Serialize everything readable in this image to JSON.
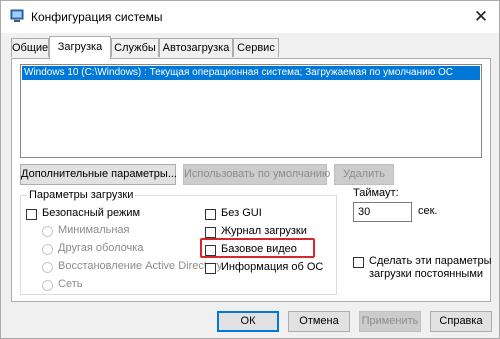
{
  "window": {
    "title": "Конфигурация системы",
    "close_glyph": "✕"
  },
  "tabs": [
    {
      "label": "Общие",
      "active": false
    },
    {
      "label": "Загрузка",
      "active": true
    },
    {
      "label": "Службы",
      "active": false
    },
    {
      "label": "Автозагрузка",
      "active": false
    },
    {
      "label": "Сервис",
      "active": false
    }
  ],
  "os_list": {
    "items": [
      {
        "label": "Windows 10 (C:\\Windows) : Текущая операционная система; Загружаемая по умолчанию ОС",
        "selected": true
      }
    ]
  },
  "os_buttons": {
    "advanced": "Дополнительные параметры...",
    "set_default": "Использовать по умолчанию",
    "delete": "Удалить"
  },
  "boot_options": {
    "group_label": "Параметры загрузки",
    "safe_boot": {
      "label": "Безопасный режим",
      "checked": false
    },
    "safe_modes": [
      {
        "label": "Минимальная",
        "checked": false
      },
      {
        "label": "Другая оболочка",
        "checked": false
      },
      {
        "label": "Восстановление Active Directory",
        "checked": false
      },
      {
        "label": "Сеть",
        "checked": false
      }
    ],
    "no_gui": {
      "label": "Без GUI",
      "checked": false
    },
    "boot_log": {
      "label": "Журнал загрузки",
      "checked": false
    },
    "base_video": {
      "label": "Базовое видео",
      "checked": false
    },
    "os_info": {
      "label": "Информация  об ОС",
      "checked": false
    }
  },
  "timeout": {
    "label": "Таймаут:",
    "value": "30",
    "unit": "сек."
  },
  "make_permanent": {
    "label_line1": "Сделать эти параметры",
    "label_line2": "загрузки постоянными",
    "checked": false
  },
  "footer_buttons": {
    "ok": "ОК",
    "cancel": "Отмена",
    "apply": "Применить",
    "help": "Справка"
  },
  "colors": {
    "selection": "#0078d7",
    "highlight_box": "#d62828"
  }
}
